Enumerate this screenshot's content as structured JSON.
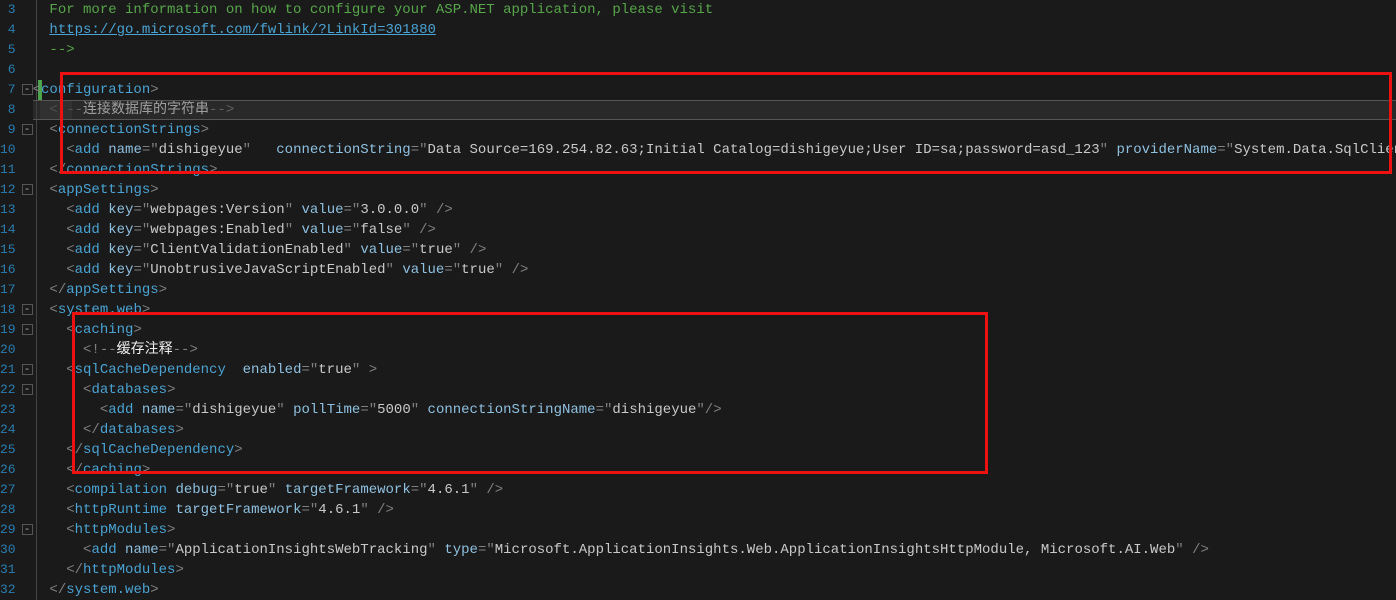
{
  "lines": {
    "3": {
      "num": "3",
      "fold": "",
      "indent": 1,
      "tokens": [
        {
          "t": "For more information on how to configure your ASP.NET application, please visit",
          "c": "comment"
        }
      ]
    },
    "4": {
      "num": "4",
      "fold": "",
      "indent": 1,
      "tokens": [
        {
          "t": "https://go.microsoft.com/fwlink/?LinkId=301880",
          "c": "link"
        }
      ]
    },
    "5": {
      "num": "5",
      "fold": "",
      "indent": 1,
      "tokens": [
        {
          "t": "-->",
          "c": "comment"
        }
      ]
    },
    "6": {
      "num": "6",
      "fold": "",
      "indent": 0,
      "tokens": []
    },
    "7": {
      "num": "7",
      "fold": "-",
      "indent": 0,
      "tokens": [
        {
          "t": "<",
          "c": "bracket"
        },
        {
          "t": "configuration",
          "c": "tag"
        },
        {
          "t": ">",
          "c": "bracket"
        }
      ]
    },
    "8": {
      "num": "8",
      "fold": "",
      "indent": 1,
      "tokens": [
        {
          "t": "<!--",
          "c": "bracket"
        },
        {
          "t": "连接数据库的字符串",
          "c": "cjk"
        },
        {
          "t": "-->",
          "c": "bracket"
        }
      ]
    },
    "9": {
      "num": "9",
      "fold": "-",
      "indent": 1,
      "tokens": [
        {
          "t": "<",
          "c": "bracket"
        },
        {
          "t": "connectionStrings",
          "c": "tag"
        },
        {
          "t": ">",
          "c": "bracket"
        }
      ]
    },
    "10": {
      "num": "10",
      "fold": "",
      "indent": 2,
      "tokens": [
        {
          "t": "<",
          "c": "bracket"
        },
        {
          "t": "add ",
          "c": "tag"
        },
        {
          "t": "name",
          "c": "attr"
        },
        {
          "t": "=\"",
          "c": "bracket"
        },
        {
          "t": "dishigeyue",
          "c": "str"
        },
        {
          "t": "\"   ",
          "c": "bracket"
        },
        {
          "t": "connectionString",
          "c": "attr"
        },
        {
          "t": "=\"",
          "c": "bracket"
        },
        {
          "t": "Data Source=169.254.82.63;Initial Catalog=dishigeyue;User ID=sa;password=asd_123",
          "c": "str"
        },
        {
          "t": "\" ",
          "c": "bracket"
        },
        {
          "t": "providerName",
          "c": "attr"
        },
        {
          "t": "=\"",
          "c": "bracket"
        },
        {
          "t": "System.Data.SqlClient",
          "c": "str"
        },
        {
          "t": "\"/>",
          "c": "bracket"
        }
      ]
    },
    "11": {
      "num": "11",
      "fold": "",
      "indent": 1,
      "tokens": [
        {
          "t": "</",
          "c": "bracket"
        },
        {
          "t": "connectionStrings",
          "c": "tag"
        },
        {
          "t": ">",
          "c": "bracket"
        }
      ]
    },
    "12": {
      "num": "12",
      "fold": "-",
      "indent": 1,
      "tokens": [
        {
          "t": "<",
          "c": "bracket"
        },
        {
          "t": "appSettings",
          "c": "tag"
        },
        {
          "t": ">",
          "c": "bracket"
        }
      ]
    },
    "13": {
      "num": "13",
      "fold": "",
      "indent": 2,
      "tokens": [
        {
          "t": "<",
          "c": "bracket"
        },
        {
          "t": "add ",
          "c": "tag"
        },
        {
          "t": "key",
          "c": "attr"
        },
        {
          "t": "=\"",
          "c": "bracket"
        },
        {
          "t": "webpages:Version",
          "c": "str"
        },
        {
          "t": "\" ",
          "c": "bracket"
        },
        {
          "t": "value",
          "c": "attr"
        },
        {
          "t": "=\"",
          "c": "bracket"
        },
        {
          "t": "3.0.0.0",
          "c": "str"
        },
        {
          "t": "\" />",
          "c": "bracket"
        }
      ]
    },
    "14": {
      "num": "14",
      "fold": "",
      "indent": 2,
      "tokens": [
        {
          "t": "<",
          "c": "bracket"
        },
        {
          "t": "add ",
          "c": "tag"
        },
        {
          "t": "key",
          "c": "attr"
        },
        {
          "t": "=\"",
          "c": "bracket"
        },
        {
          "t": "webpages:Enabled",
          "c": "str"
        },
        {
          "t": "\" ",
          "c": "bracket"
        },
        {
          "t": "value",
          "c": "attr"
        },
        {
          "t": "=\"",
          "c": "bracket"
        },
        {
          "t": "false",
          "c": "str"
        },
        {
          "t": "\" />",
          "c": "bracket"
        }
      ]
    },
    "15": {
      "num": "15",
      "fold": "",
      "indent": 2,
      "tokens": [
        {
          "t": "<",
          "c": "bracket"
        },
        {
          "t": "add ",
          "c": "tag"
        },
        {
          "t": "key",
          "c": "attr"
        },
        {
          "t": "=\"",
          "c": "bracket"
        },
        {
          "t": "ClientValidationEnabled",
          "c": "str"
        },
        {
          "t": "\" ",
          "c": "bracket"
        },
        {
          "t": "value",
          "c": "attr"
        },
        {
          "t": "=\"",
          "c": "bracket"
        },
        {
          "t": "true",
          "c": "str"
        },
        {
          "t": "\" />",
          "c": "bracket"
        }
      ]
    },
    "16": {
      "num": "16",
      "fold": "",
      "indent": 2,
      "tokens": [
        {
          "t": "<",
          "c": "bracket"
        },
        {
          "t": "add ",
          "c": "tag"
        },
        {
          "t": "key",
          "c": "attr"
        },
        {
          "t": "=\"",
          "c": "bracket"
        },
        {
          "t": "UnobtrusiveJavaScriptEnabled",
          "c": "str"
        },
        {
          "t": "\" ",
          "c": "bracket"
        },
        {
          "t": "value",
          "c": "attr"
        },
        {
          "t": "=\"",
          "c": "bracket"
        },
        {
          "t": "true",
          "c": "str"
        },
        {
          "t": "\" />",
          "c": "bracket"
        }
      ]
    },
    "17": {
      "num": "17",
      "fold": "",
      "indent": 1,
      "tokens": [
        {
          "t": "</",
          "c": "bracket"
        },
        {
          "t": "appSettings",
          "c": "tag"
        },
        {
          "t": ">",
          "c": "bracket"
        }
      ]
    },
    "18": {
      "num": "18",
      "fold": "-",
      "indent": 1,
      "tokens": [
        {
          "t": "<",
          "c": "bracket"
        },
        {
          "t": "system.web",
          "c": "tag"
        },
        {
          "t": ">",
          "c": "bracket"
        }
      ]
    },
    "19": {
      "num": "19",
      "fold": "-",
      "indent": 2,
      "tokens": [
        {
          "t": "<",
          "c": "bracket"
        },
        {
          "t": "caching",
          "c": "tag"
        },
        {
          "t": ">",
          "c": "bracket"
        }
      ]
    },
    "20": {
      "num": "20",
      "fold": "",
      "indent": 3,
      "tokens": [
        {
          "t": "<!--",
          "c": "bracket"
        },
        {
          "t": "缓存注释",
          "c": "cjk"
        },
        {
          "t": "-->",
          "c": "bracket"
        }
      ]
    },
    "21": {
      "num": "21",
      "fold": "-",
      "indent": 2,
      "tokens": [
        {
          "t": "<",
          "c": "bracket"
        },
        {
          "t": "sqlCacheDependency  ",
          "c": "tag"
        },
        {
          "t": "enabled",
          "c": "attr"
        },
        {
          "t": "=\"",
          "c": "bracket"
        },
        {
          "t": "true",
          "c": "str"
        },
        {
          "t": "\" >",
          "c": "bracket"
        }
      ]
    },
    "22": {
      "num": "22",
      "fold": "-",
      "indent": 3,
      "tokens": [
        {
          "t": "<",
          "c": "bracket"
        },
        {
          "t": "databases",
          "c": "tag"
        },
        {
          "t": ">",
          "c": "bracket"
        }
      ]
    },
    "23": {
      "num": "23",
      "fold": "",
      "indent": 4,
      "tokens": [
        {
          "t": "<",
          "c": "bracket"
        },
        {
          "t": "add ",
          "c": "tag"
        },
        {
          "t": "name",
          "c": "attr"
        },
        {
          "t": "=\"",
          "c": "bracket"
        },
        {
          "t": "dishigeyue",
          "c": "str"
        },
        {
          "t": "\" ",
          "c": "bracket"
        },
        {
          "t": "pollTime",
          "c": "attr"
        },
        {
          "t": "=\"",
          "c": "bracket"
        },
        {
          "t": "5000",
          "c": "str"
        },
        {
          "t": "\" ",
          "c": "bracket"
        },
        {
          "t": "connectionStringName",
          "c": "attr"
        },
        {
          "t": "=\"",
          "c": "bracket"
        },
        {
          "t": "dishigeyue",
          "c": "str"
        },
        {
          "t": "\"/>",
          "c": "bracket"
        }
      ]
    },
    "24": {
      "num": "24",
      "fold": "",
      "indent": 3,
      "tokens": [
        {
          "t": "</",
          "c": "bracket"
        },
        {
          "t": "databases",
          "c": "tag"
        },
        {
          "t": ">",
          "c": "bracket"
        }
      ]
    },
    "25": {
      "num": "25",
      "fold": "",
      "indent": 2,
      "tokens": [
        {
          "t": "</",
          "c": "bracket"
        },
        {
          "t": "sqlCacheDependency",
          "c": "tag"
        },
        {
          "t": ">",
          "c": "bracket"
        }
      ]
    },
    "26": {
      "num": "26",
      "fold": "",
      "indent": 2,
      "tokens": [
        {
          "t": "</",
          "c": "bracket"
        },
        {
          "t": "caching",
          "c": "tag"
        },
        {
          "t": ">",
          "c": "bracket"
        }
      ]
    },
    "27": {
      "num": "27",
      "fold": "",
      "indent": 2,
      "tokens": [
        {
          "t": "<",
          "c": "bracket"
        },
        {
          "t": "compilation ",
          "c": "tag"
        },
        {
          "t": "debug",
          "c": "attr"
        },
        {
          "t": "=\"",
          "c": "bracket"
        },
        {
          "t": "true",
          "c": "str"
        },
        {
          "t": "\" ",
          "c": "bracket"
        },
        {
          "t": "targetFramework",
          "c": "attr"
        },
        {
          "t": "=\"",
          "c": "bracket"
        },
        {
          "t": "4.6.1",
          "c": "str"
        },
        {
          "t": "\" />",
          "c": "bracket"
        }
      ]
    },
    "28": {
      "num": "28",
      "fold": "",
      "indent": 2,
      "tokens": [
        {
          "t": "<",
          "c": "bracket"
        },
        {
          "t": "httpRuntime ",
          "c": "tag"
        },
        {
          "t": "targetFramework",
          "c": "attr"
        },
        {
          "t": "=\"",
          "c": "bracket"
        },
        {
          "t": "4.6.1",
          "c": "str"
        },
        {
          "t": "\" />",
          "c": "bracket"
        }
      ]
    },
    "29": {
      "num": "29",
      "fold": "-",
      "indent": 2,
      "tokens": [
        {
          "t": "<",
          "c": "bracket"
        },
        {
          "t": "httpModules",
          "c": "tag"
        },
        {
          "t": ">",
          "c": "bracket"
        }
      ]
    },
    "30": {
      "num": "30",
      "fold": "",
      "indent": 3,
      "tokens": [
        {
          "t": "<",
          "c": "bracket"
        },
        {
          "t": "add ",
          "c": "tag"
        },
        {
          "t": "name",
          "c": "attr"
        },
        {
          "t": "=\"",
          "c": "bracket"
        },
        {
          "t": "ApplicationInsightsWebTracking",
          "c": "str"
        },
        {
          "t": "\" ",
          "c": "bracket"
        },
        {
          "t": "type",
          "c": "attr"
        },
        {
          "t": "=\"",
          "c": "bracket"
        },
        {
          "t": "Microsoft.ApplicationInsights.Web.ApplicationInsightsHttpModule, Microsoft.AI.Web",
          "c": "str"
        },
        {
          "t": "\" />",
          "c": "bracket"
        }
      ]
    },
    "31": {
      "num": "31",
      "fold": "",
      "indent": 2,
      "tokens": [
        {
          "t": "</",
          "c": "bracket"
        },
        {
          "t": "httpModules",
          "c": "tag"
        },
        {
          "t": ">",
          "c": "bracket"
        }
      ]
    },
    "32": {
      "num": "32",
      "fold": "",
      "indent": 1,
      "tokens": [
        {
          "t": "</",
          "c": "bracket"
        },
        {
          "t": "system.web",
          "c": "tag"
        },
        {
          "t": ">",
          "c": "bracket"
        }
      ]
    }
  },
  "order": [
    "3",
    "4",
    "5",
    "6",
    "7",
    "8",
    "9",
    "10",
    "11",
    "12",
    "13",
    "14",
    "15",
    "16",
    "17",
    "18",
    "19",
    "20",
    "21",
    "22",
    "23",
    "24",
    "25",
    "26",
    "27",
    "28",
    "29",
    "30",
    "31",
    "32"
  ],
  "currentLine": "8"
}
